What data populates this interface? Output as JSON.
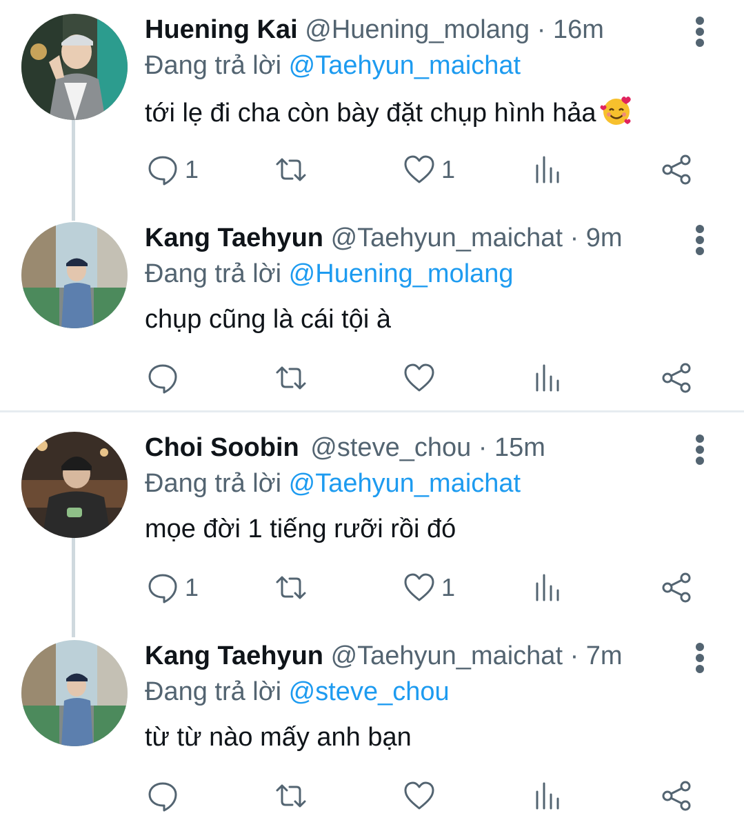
{
  "threads": [
    {
      "tweets": [
        {
          "name": "Huening Kai",
          "handle": "@Huening_molang",
          "separator": "·",
          "time": "16m",
          "reply_prefix": "Đang trả lời",
          "reply_to": "@Taehyun_maichat",
          "text": "tới lẹ đi cha còn bày đặt chụp hình hảa",
          "emoji": "smiling-face-with-hearts",
          "reply_count": "1",
          "like_count": "1"
        },
        {
          "name": "Kang Taehyun",
          "handle": "@Taehyun_maichat",
          "separator": "·",
          "time": "9m",
          "reply_prefix": "Đang trả lời",
          "reply_to": "@Huening_molang",
          "text": "chụp cũng là cái tội à",
          "reply_count": "",
          "like_count": ""
        }
      ]
    },
    {
      "tweets": [
        {
          "name": "Choi Soobin",
          "handle": "@steve_chou",
          "separator": "·",
          "time": "15m",
          "reply_prefix": "Đang trả lời",
          "reply_to": "@Taehyun_maichat",
          "text": "mọe đời 1 tiếng rưỡi rồi đó",
          "reply_count": "1",
          "like_count": "1"
        },
        {
          "name": "Kang Taehyun",
          "handle": "@Taehyun_maichat",
          "separator": "·",
          "time": "7m",
          "reply_prefix": "Đang trả lời",
          "reply_to": "@steve_chou",
          "text": "từ từ nào mấy anh bạn",
          "reply_count": "",
          "like_count": ""
        }
      ]
    }
  ],
  "icons": {
    "reply": "reply-bubble-icon",
    "retweet": "retweet-arrows-icon",
    "like": "heart-icon",
    "views": "bar-chart-icon",
    "share": "share-nodes-icon",
    "more": "more-vertical-icon"
  },
  "colors": {
    "mention": "#1d9bf0",
    "muted": "#536471",
    "thread_line": "#cfd9de"
  }
}
